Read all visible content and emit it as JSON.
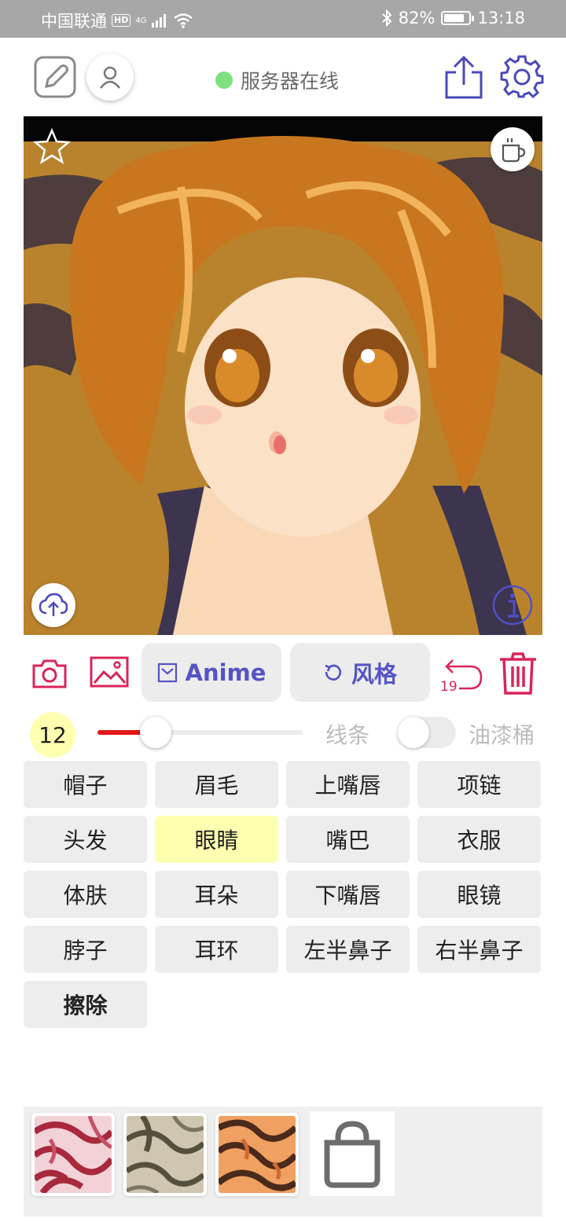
{
  "status_bar": {
    "carrier": "中国联通",
    "hd": "HD",
    "network": "4G",
    "battery": "82%",
    "battery_level": 0.82,
    "time": "13:18"
  },
  "header": {
    "server_status": "服务器在线",
    "server_status_color": "#7ee07e"
  },
  "toolbar": {
    "anime_label": "Anime",
    "style_label": "风格",
    "undo_count": "19",
    "accent_color": "#d8245a",
    "primary_color": "#5454c4"
  },
  "brush": {
    "size": "12",
    "slider_value": 0.2,
    "line_label": "线条",
    "bucket_label": "油漆桶",
    "bucket_enabled": false
  },
  "parts": [
    {
      "label": "帽子"
    },
    {
      "label": "眉毛"
    },
    {
      "label": "上嘴唇"
    },
    {
      "label": "项链"
    },
    {
      "label": "头发"
    },
    {
      "label": "眼睛",
      "selected": true
    },
    {
      "label": "嘴巴"
    },
    {
      "label": "衣服"
    },
    {
      "label": "体肤"
    },
    {
      "label": "耳朵"
    },
    {
      "label": "下嘴唇"
    },
    {
      "label": "眼镜"
    },
    {
      "label": "脖子"
    },
    {
      "label": "耳环"
    },
    {
      "label": "左半鼻子"
    },
    {
      "label": "右半鼻子"
    },
    {
      "label": "擦除",
      "bold": true
    }
  ],
  "palette": {
    "swatches": [
      {
        "name": "pink-marble-texture",
        "base": "#f2d2d6",
        "stroke": "#a8283c"
      },
      {
        "name": "olive-marble-texture",
        "base": "#cfc6b0",
        "stroke": "#55503c"
      },
      {
        "name": "orange-marble-texture",
        "base": "#f0a060",
        "stroke": "#4a2a1a"
      }
    ]
  }
}
